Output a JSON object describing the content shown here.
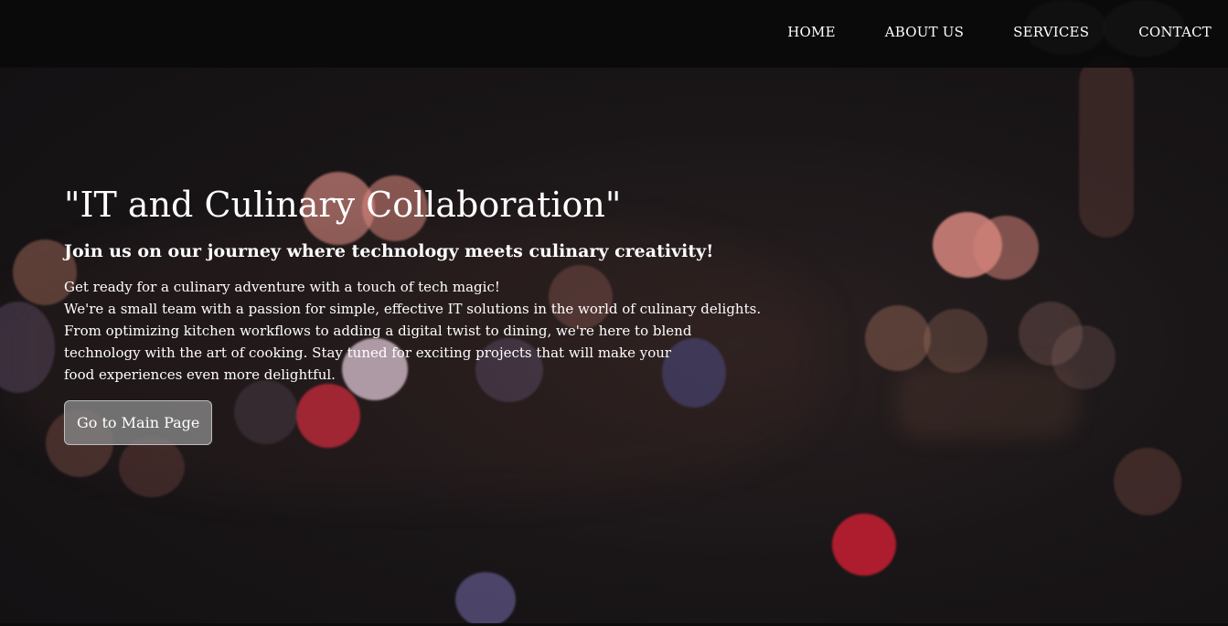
{
  "nav": {
    "items": [
      {
        "label": "HOME"
      },
      {
        "label": "ABOUT US"
      },
      {
        "label": "SERVICES"
      },
      {
        "label": "CONTACT"
      }
    ]
  },
  "hero": {
    "title": "\"IT and Culinary Collaboration\"",
    "subtitle": "Join us on our journey where technology meets culinary creativity!",
    "body_lines": [
      "Get ready for a culinary adventure with a touch of tech magic!",
      "We're a small team with a passion for simple, effective IT solutions in the world of culinary delights.",
      "From optimizing kitchen workflows to adding a digital twist to dining, we're here to blend",
      "technology with the art of cooking. Stay tuned for exciting projects that will make your",
      "food experiences even more delightful."
    ],
    "button_label": "Go to Main Page"
  },
  "colors": {
    "navbar_bg": "#0a0a0a",
    "text": "#ffffff",
    "button_bg": "#808080"
  }
}
